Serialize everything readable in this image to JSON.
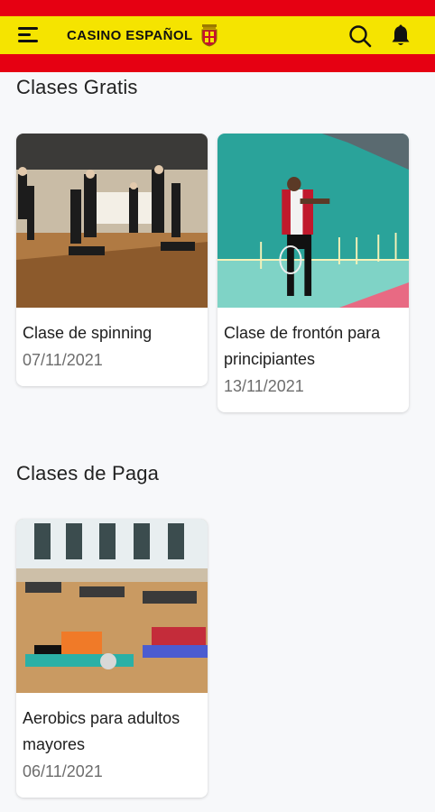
{
  "header": {
    "brand": "CASINO ESPAÑOL",
    "colors": {
      "red": "#e60012",
      "yellow": "#f5e400"
    },
    "icons": [
      "menu-icon",
      "crest-icon",
      "search-icon",
      "bell-icon"
    ]
  },
  "sections": [
    {
      "title": "Clases Gratis",
      "cards": [
        {
          "title": "Clase de spinning",
          "date": "07/11/2021",
          "image": "spinning-class-photo"
        },
        {
          "title": "Clase de frontón para principiantes",
          "date": "13/11/2021",
          "image": "fronton-player-photo"
        }
      ]
    },
    {
      "title": "Clases de Paga",
      "cards": [
        {
          "title": "Aerobics para adultos mayores",
          "date": "06/11/2021",
          "image": "aerobics-class-photo"
        }
      ]
    }
  ]
}
